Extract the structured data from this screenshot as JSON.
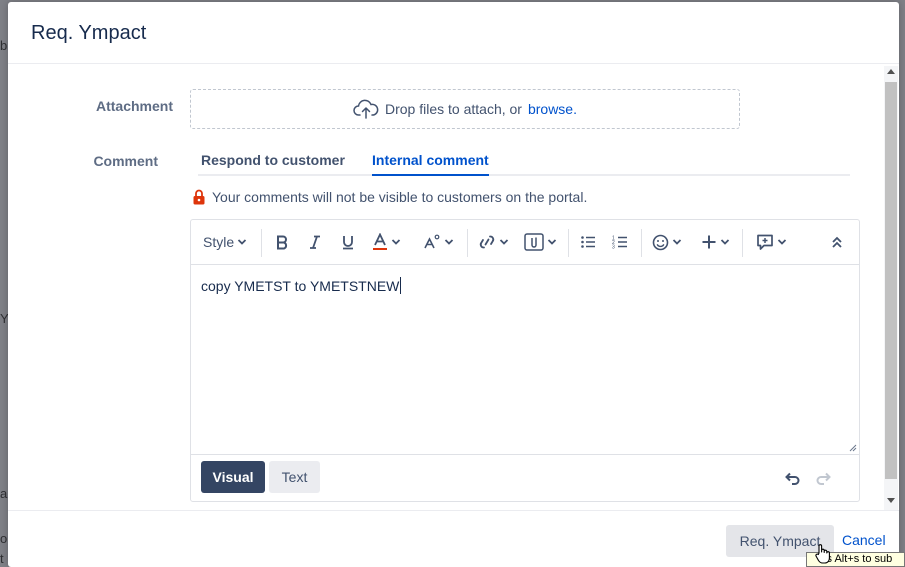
{
  "modal": {
    "title": "Req. Ympact"
  },
  "form": {
    "attachment_label": "Attachment",
    "dropzone_text": "Drop files to attach, or",
    "dropzone_link": "browse.",
    "comment_label": "Comment"
  },
  "comment_tabs": [
    {
      "label": "Respond to customer",
      "active": false
    },
    {
      "label": "Internal comment",
      "active": true
    }
  ],
  "notice": "Your comments will not be visible to customers on the portal.",
  "toolbar": {
    "style_label": "Style",
    "icons": [
      "bold-icon",
      "italic-icon",
      "underline-icon",
      "text-color-icon",
      "formatting-icon",
      "link-icon",
      "attachment-icon",
      "bullet-list-icon",
      "numbered-list-icon",
      "emoji-icon",
      "insert-icon",
      "comment-icon",
      "collapse-icon"
    ]
  },
  "editor": {
    "content": "copy YMETST to YMETSTNEW"
  },
  "modes": {
    "visual": "Visual",
    "text": "Text"
  },
  "footer": {
    "submit_label": "Req. Ympact",
    "cancel_label": "Cancel"
  },
  "tooltip": {
    "text": "ss Alt+s to sub"
  },
  "colors": {
    "link": "#0052cc",
    "visual_button": "#344563",
    "lock": "#de350b",
    "text_color_underline": "#de350b"
  }
}
